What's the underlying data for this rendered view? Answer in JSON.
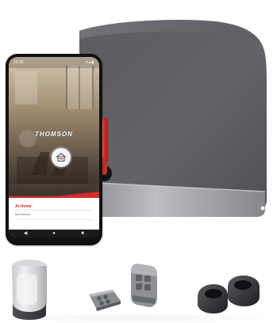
{
  "phone": {
    "status_time": "12:30",
    "status_icons": "▾▴▮",
    "brand": "THOMSON",
    "card_title": "At Home",
    "card_subtitle": "Bienvenue",
    "nav_back": "◀",
    "nav_home": "●",
    "nav_recent": "■",
    "icon_name": "home-gate-icon"
  },
  "scene": {
    "product_colors": {
      "motor_body": "#5f6063",
      "motor_top": "#6a6b6f",
      "motor_base": "#a7a8ab",
      "lever": "#d82b1f",
      "phone_accent": "#d72a2d"
    },
    "accessories": [
      "lamp",
      "remote-flat",
      "remote-tall",
      "photocells"
    ]
  }
}
